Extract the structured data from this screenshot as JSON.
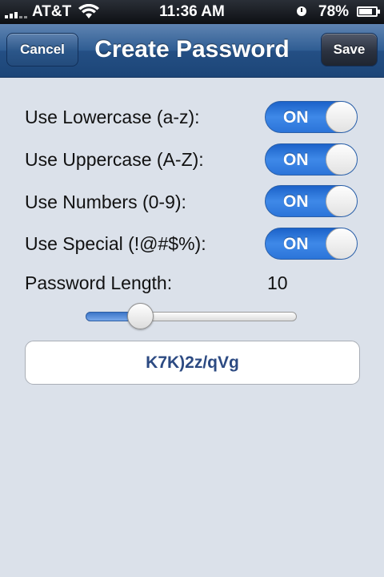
{
  "status_bar": {
    "carrier": "AT&T",
    "time": "11:36 AM",
    "battery_percent": "78%",
    "battery_level": 0.78
  },
  "nav": {
    "title": "Create Password",
    "cancel_label": "Cancel",
    "save_label": "Save"
  },
  "options": [
    {
      "label": "Use Lowercase (a-z):",
      "toggle_label": "ON",
      "state": true
    },
    {
      "label": "Use Uppercase (A-Z):",
      "toggle_label": "ON",
      "state": true
    },
    {
      "label": "Use Numbers (0-9):",
      "toggle_label": "ON",
      "state": true
    },
    {
      "label": "Use Special (!@#$%):",
      "toggle_label": "ON",
      "state": true
    }
  ],
  "length": {
    "label": "Password Length:",
    "value": "10"
  },
  "password": {
    "value": "K7K)2z/qVg"
  }
}
